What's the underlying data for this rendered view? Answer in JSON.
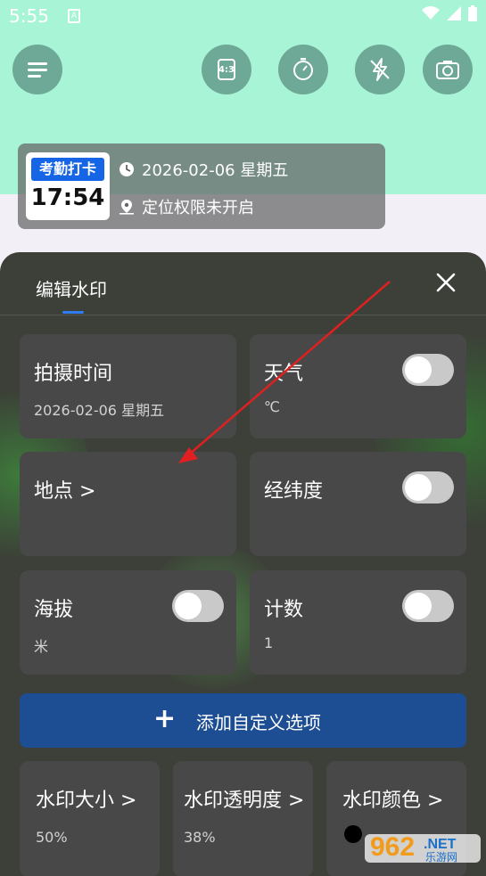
{
  "status_bar": {
    "time": "5:55",
    "sim_label": "A"
  },
  "camera_controls": [
    {
      "id": "menu",
      "icon": "menu-icon"
    },
    {
      "id": "ratio",
      "icon": "aspect-ratio-icon",
      "label": "4:3"
    },
    {
      "id": "timer",
      "icon": "timer-icon"
    },
    {
      "id": "flash",
      "icon": "flash-off-icon"
    },
    {
      "id": "switch",
      "icon": "camera-switch-icon"
    }
  ],
  "watermark": {
    "badge_label": "考勤打卡",
    "clock": "17:54",
    "date_line": "2026-02-06 星期五",
    "location_line": "定位权限未开启"
  },
  "sheet": {
    "title": "编辑水印",
    "tiles": {
      "shoot_time": {
        "label": "拍摄时间",
        "sub": "2026-02-06 星期五"
      },
      "weather": {
        "label": "天气",
        "sub": "℃",
        "toggle_on": false
      },
      "location": {
        "label": "地点 >"
      },
      "latlng": {
        "label": "经纬度",
        "toggle_on": false
      },
      "altitude": {
        "label": "海拔",
        "sub": "米",
        "toggle_on": false
      },
      "count": {
        "label": "计数",
        "sub": "1",
        "toggle_on": false
      }
    },
    "add_button": {
      "plus": "+",
      "label": "添加自定义选项"
    },
    "bottom_tiles": [
      {
        "label": "水印大小 >",
        "sub": "50%"
      },
      {
        "label": "水印透明度 >",
        "sub": "38%"
      },
      {
        "label": "水印颜色 >",
        "color": "#000000"
      }
    ]
  },
  "site_logo": {
    "main": "962",
    "suffix": ".NET",
    "sub": "乐游网"
  },
  "colors": {
    "accent_blue": "#1565e6",
    "add_button": "#1d4d93",
    "annotation_arrow": "#e02020"
  }
}
